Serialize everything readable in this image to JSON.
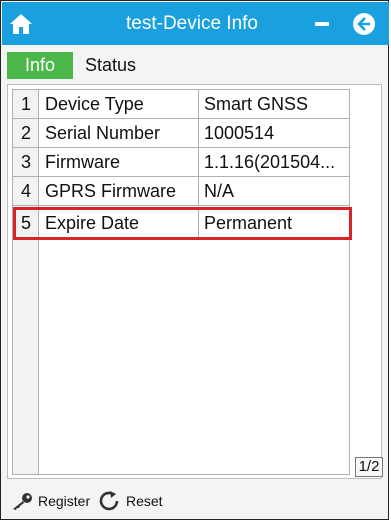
{
  "window": {
    "title": "test-Device Info"
  },
  "tabs": [
    {
      "label": "Info",
      "active": true
    },
    {
      "label": "Status",
      "active": false
    }
  ],
  "table": {
    "rows": [
      {
        "num": "1",
        "name": "Device Type",
        "value": "Smart GNSS"
      },
      {
        "num": "2",
        "name": "Serial Number",
        "value": "1000514"
      },
      {
        "num": "3",
        "name": "Firmware",
        "value": "1.1.16(201504..."
      },
      {
        "num": "4",
        "name": "GPRS Firmware",
        "value": "N/A"
      },
      {
        "num": "5",
        "name": "Expire Date",
        "value": "Permanent"
      }
    ],
    "highlighted_row": 5
  },
  "pager": {
    "label": "1/2"
  },
  "bottom": {
    "register_label": "Register",
    "reset_label": "Reset"
  },
  "colors": {
    "titlebar": "#1aa0df",
    "tab_active": "#4cb749",
    "highlight": "#d9222a"
  },
  "icons": {
    "home": "home-icon",
    "minimize": "minimize-icon",
    "back": "back-arrow-icon",
    "register": "key-icon",
    "reset": "refresh-icon"
  }
}
